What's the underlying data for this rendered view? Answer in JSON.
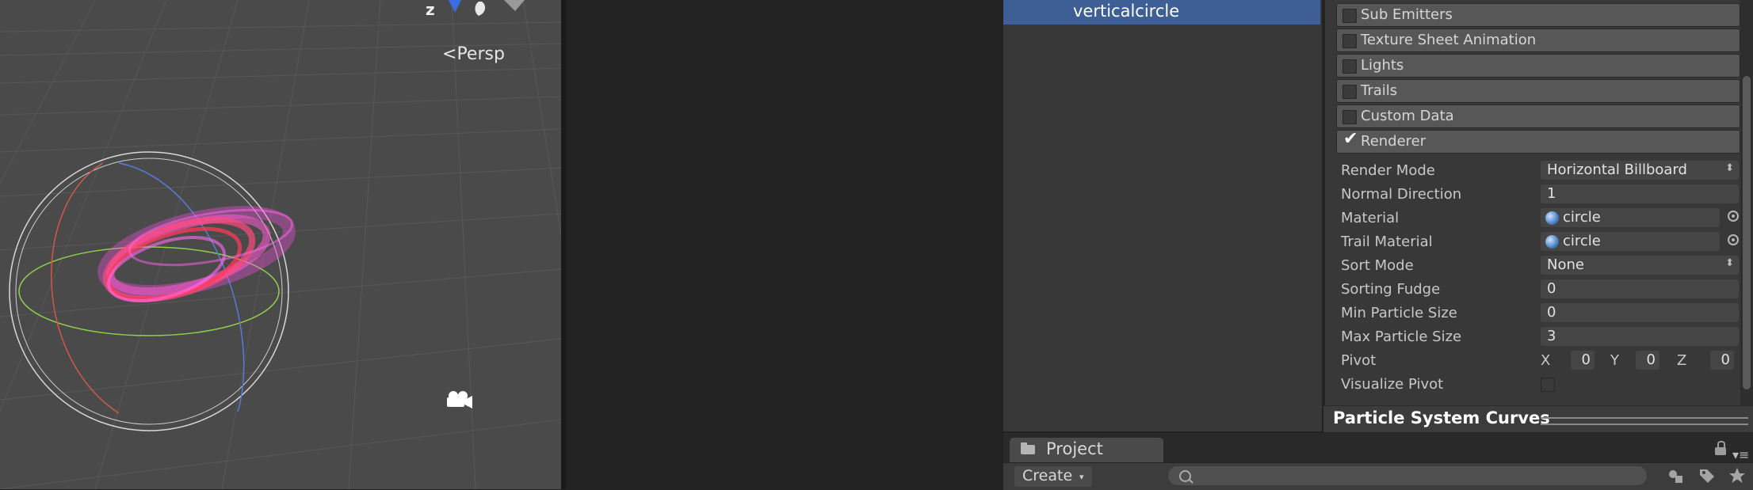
{
  "scene": {
    "persp_label": "Persp",
    "gizmo_axis_label": "z"
  },
  "hierarchy": {
    "selected_item": "verticalcircle"
  },
  "inspector": {
    "modules": [
      {
        "label": "Sub Emitters",
        "enabled": false
      },
      {
        "label": "Texture Sheet Animation",
        "enabled": false
      },
      {
        "label": "Lights",
        "enabled": false
      },
      {
        "label": "Trails",
        "enabled": false
      },
      {
        "label": "Custom Data",
        "enabled": false
      },
      {
        "label": "Renderer",
        "enabled": true
      }
    ],
    "check_glyph": "✔",
    "renderer": {
      "render_mode_label": "Render Mode",
      "render_mode_value": "Horizontal Billboard",
      "normal_direction_label": "Normal Direction",
      "normal_direction_value": "1",
      "material_label": "Material",
      "material_value": "circle",
      "trail_material_label": "Trail Material",
      "trail_material_value": "circle",
      "sort_mode_label": "Sort Mode",
      "sort_mode_value": "None",
      "sorting_fudge_label": "Sorting Fudge",
      "sorting_fudge_value": "0",
      "min_particle_size_label": "Min Particle Size",
      "min_particle_size_value": "0",
      "max_particle_size_label": "Max Particle Size",
      "max_particle_size_value": "3",
      "pivot_label": "Pivot",
      "pivot_x_label": "X",
      "pivot_x": "0",
      "pivot_y_label": "Y",
      "pivot_y": "0",
      "pivot_z_label": "Z",
      "pivot_z": "0",
      "visualize_pivot_label": "Visualize Pivot",
      "visualize_pivot": false
    },
    "dropdown_glyph": "⬍",
    "curves_title": "Particle System Curves"
  },
  "project": {
    "tab_label": "Project",
    "create_label": "Create",
    "create_arrow": "▾",
    "search_placeholder": "",
    "menu_glyph": "▾≡"
  },
  "colors": {
    "selection": "#3e5f96",
    "particle_pink": "#ff4fe6",
    "particle_red": "#ff3a5a"
  }
}
